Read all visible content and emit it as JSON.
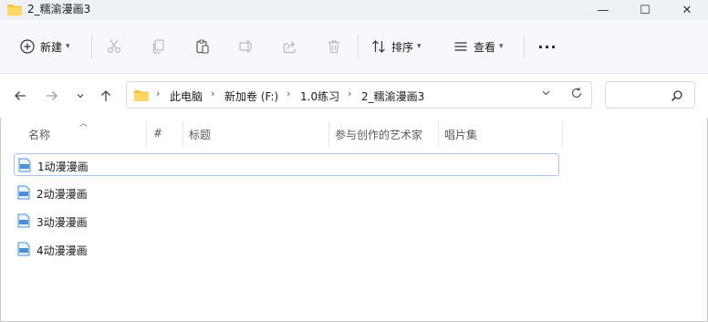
{
  "window": {
    "title": "2_糯渝漫画3",
    "controls": {
      "minimize": "—",
      "maximize": "☐",
      "close": "✕"
    }
  },
  "toolbar": {
    "new_label": "新建",
    "sort_label": "排序",
    "view_label": "查看",
    "more_label": "···",
    "icons": [
      "plus-circle-icon",
      "cut-icon",
      "copy-icon",
      "paste-icon",
      "rename-icon",
      "share-icon",
      "delete-icon",
      "sort-icon",
      "view-icon"
    ]
  },
  "address": {
    "crumbs": [
      "此电脑",
      "新加卷 (F:)",
      "1.0练习",
      "2_糯渝漫画3"
    ]
  },
  "columns": [
    "名称",
    "#",
    "标题",
    "参与创作的艺术家",
    "唱片集"
  ],
  "files": [
    {
      "name": "1动漫漫画",
      "selected": true
    },
    {
      "name": "2动漫漫画",
      "selected": false
    },
    {
      "name": "3动漫漫画",
      "selected": false
    },
    {
      "name": "4动漫漫画",
      "selected": false
    }
  ],
  "colors": {
    "folder": "#f5c542",
    "selection_border": "#a9c6e8",
    "file_icon": "#4a90d9"
  }
}
